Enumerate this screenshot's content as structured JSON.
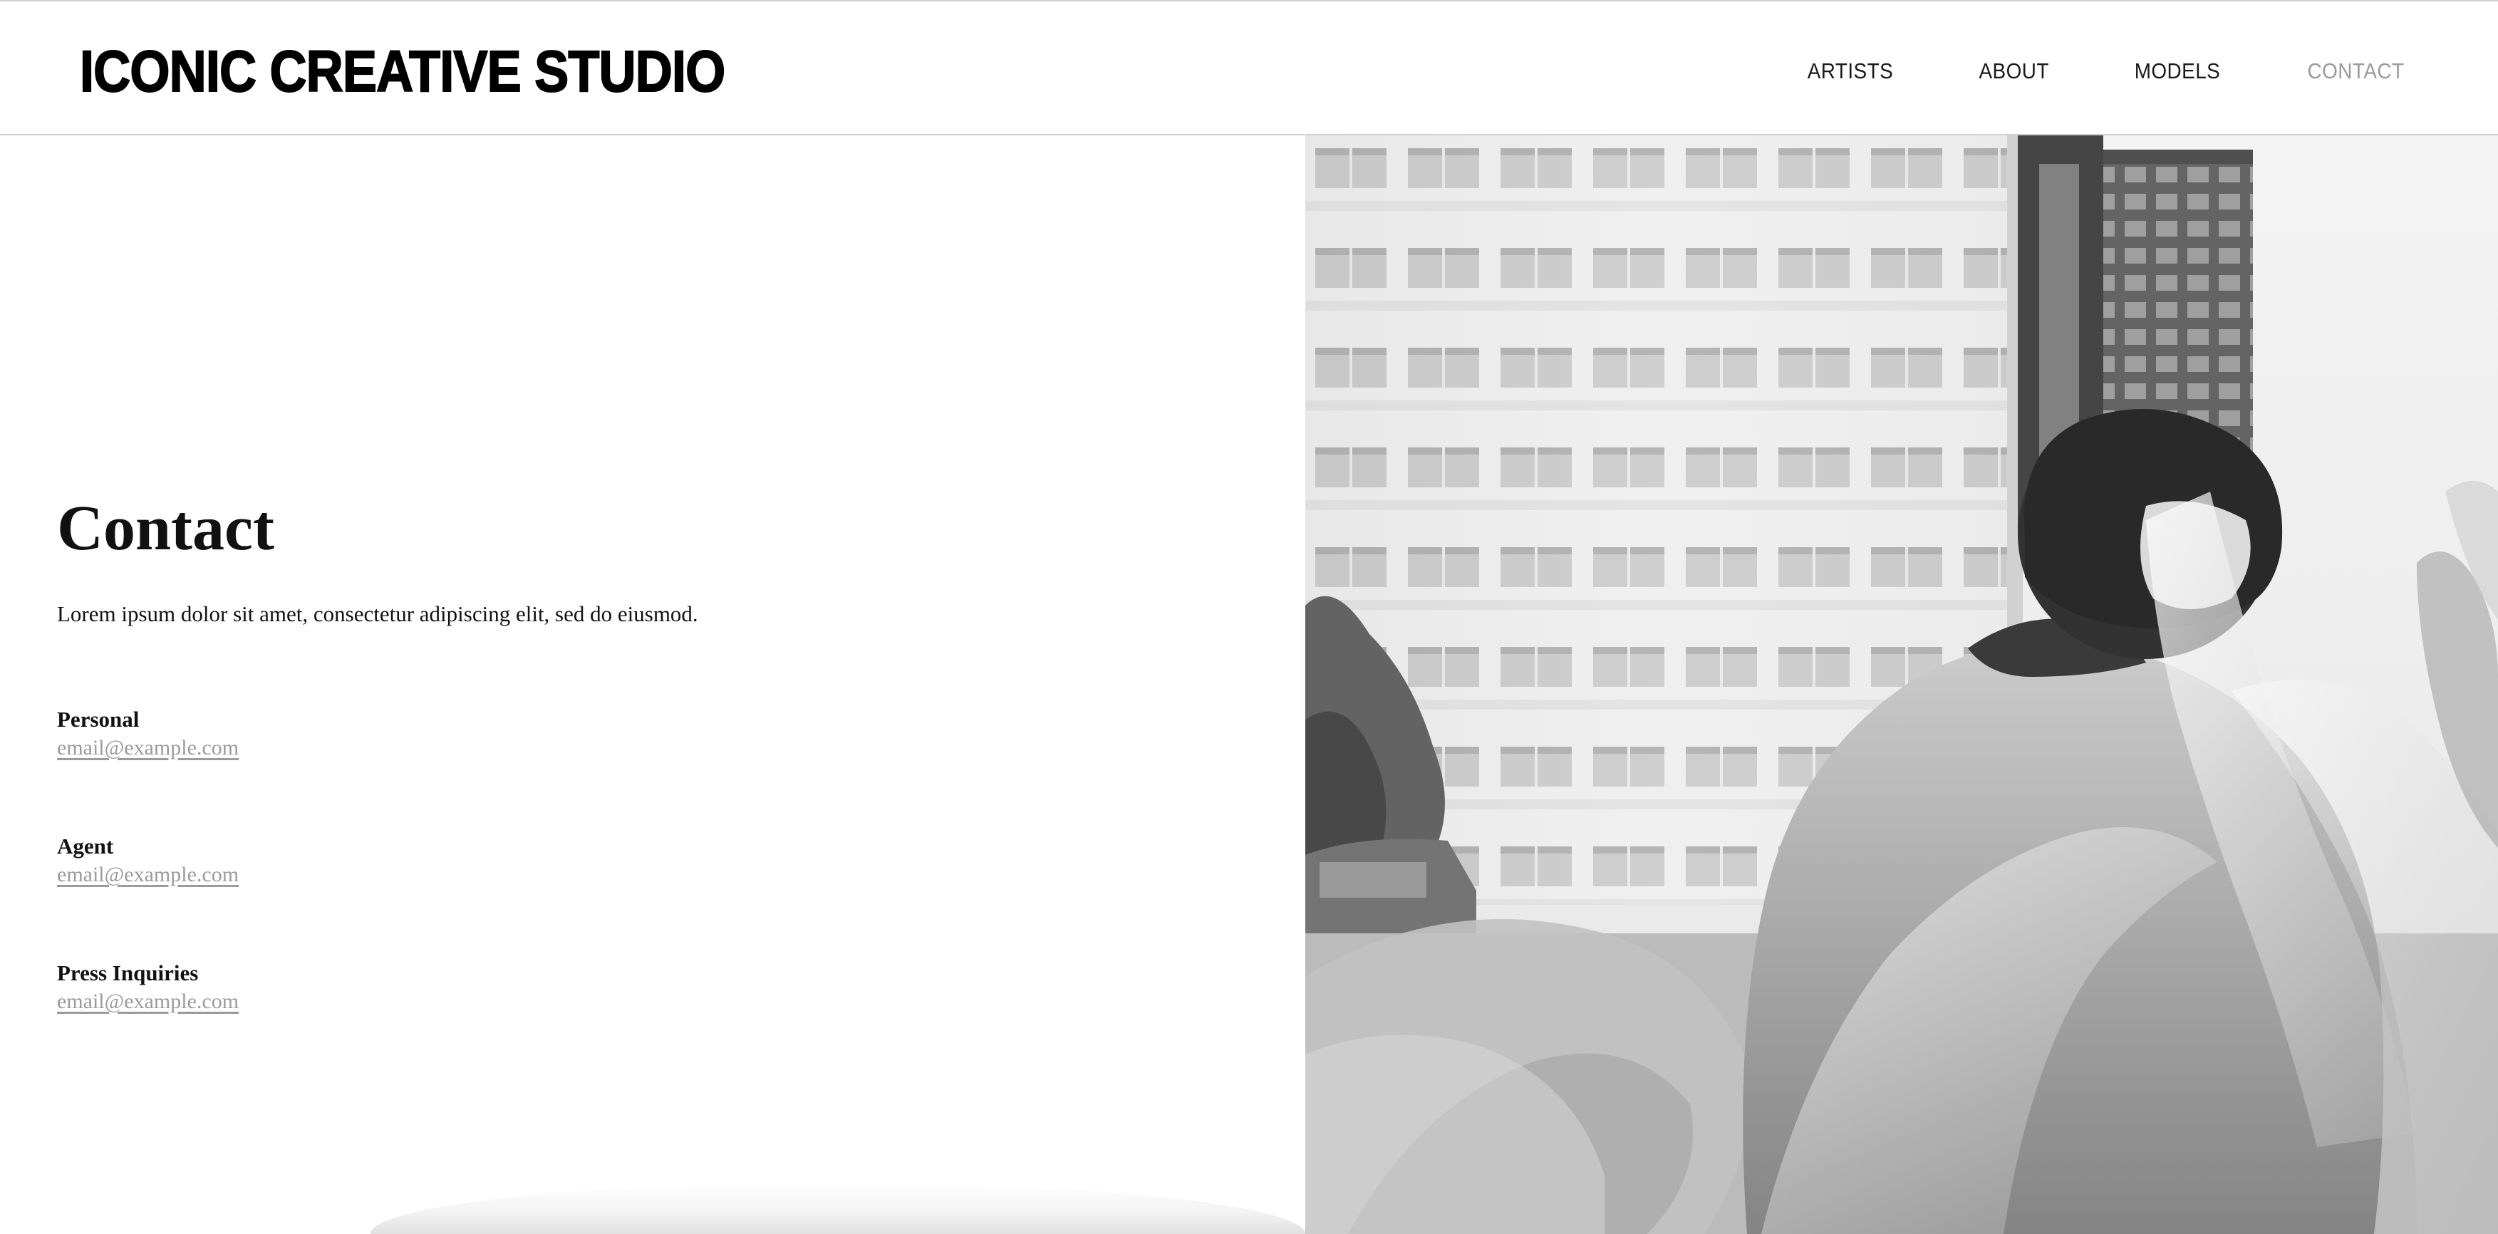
{
  "header": {
    "logo": "ICONIC CREATIVE STUDIO",
    "nav": [
      {
        "label": "ARTISTS",
        "active": false
      },
      {
        "label": "ABOUT",
        "active": false
      },
      {
        "label": "MODELS",
        "active": false
      },
      {
        "label": "CONTACT",
        "active": true
      }
    ]
  },
  "main": {
    "title": "Contact",
    "intro": "Lorem ipsum dolor sit amet, consectetur adipiscing elit, sed do eiusmod.",
    "contacts": [
      {
        "label": "Personal",
        "email": "email@example.com"
      },
      {
        "label": "Agent",
        "email": "email@example.com"
      },
      {
        "label": "Press Inquiries",
        "email": "email@example.com"
      }
    ]
  },
  "hero_image": {
    "subject": "black-and-white photo of a person with short dark hair wrapped in sheer fabric in front of an office building"
  },
  "colors": {
    "text": "#111111",
    "muted_link": "#9b9b9b",
    "active_nav": "#9a9a9a",
    "divider": "#cfcfcf"
  }
}
